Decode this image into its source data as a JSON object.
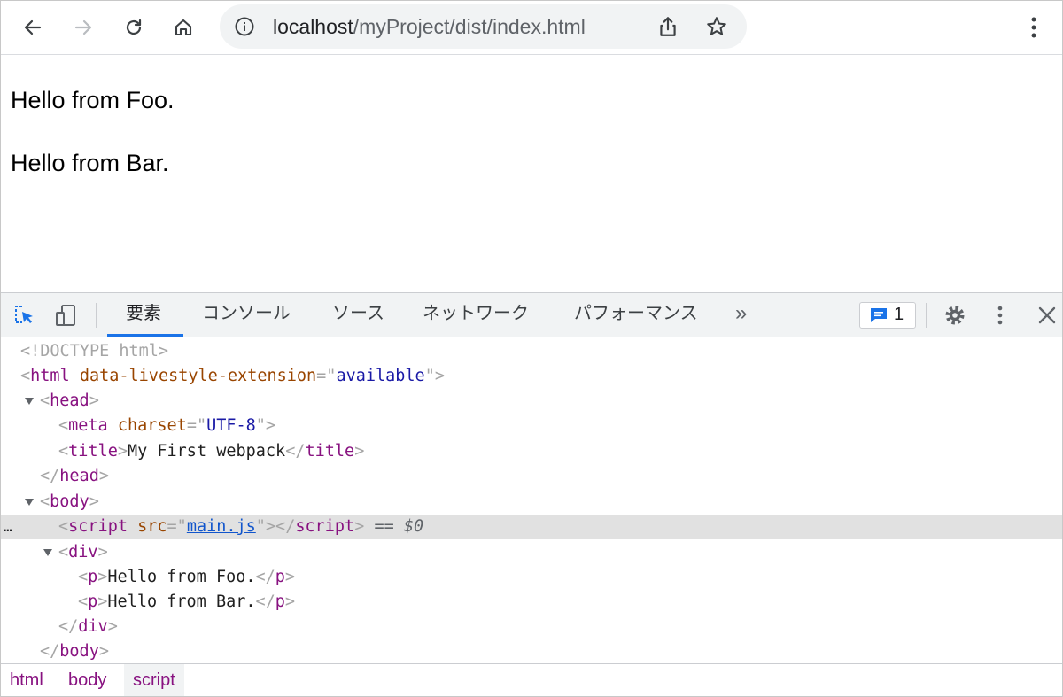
{
  "browser": {
    "url_host": "localhost",
    "url_path": "/myProject/dist/index.html",
    "icons": [
      "back-arrow-icon",
      "forward-arrow-icon",
      "reload-icon",
      "home-icon",
      "info-icon",
      "share-icon",
      "star-icon",
      "more-vertical-icon"
    ]
  },
  "page": {
    "paragraphs": [
      "Hello from Foo.",
      "Hello from Bar."
    ]
  },
  "devtools": {
    "tabs": [
      "要素",
      "コンソール",
      "ソース",
      "ネットワーク",
      "パフォーマンス"
    ],
    "active_tab": "要素",
    "more_tabs": "»",
    "issues_count": "1",
    "dom": {
      "doctype": "<!DOCTYPE html>",
      "html_tag": "html",
      "html_attr_name": "data-livestyle-extension",
      "html_attr_value": "available",
      "head_tag": "head",
      "meta_tag": "meta",
      "meta_attr_name": "charset",
      "meta_attr_value": "UTF-8",
      "title_tag": "title",
      "title_text": "My First webpack",
      "body_tag": "body",
      "script_tag": "script",
      "script_attr_name": "src",
      "script_attr_value": "main.js",
      "selected_marker": "== $0",
      "div_tag": "div",
      "p_tag": "p",
      "p1_text": "Hello from Foo.",
      "p2_text": "Hello from Bar."
    },
    "breadcrumbs": [
      "html",
      "body",
      "script"
    ]
  }
}
